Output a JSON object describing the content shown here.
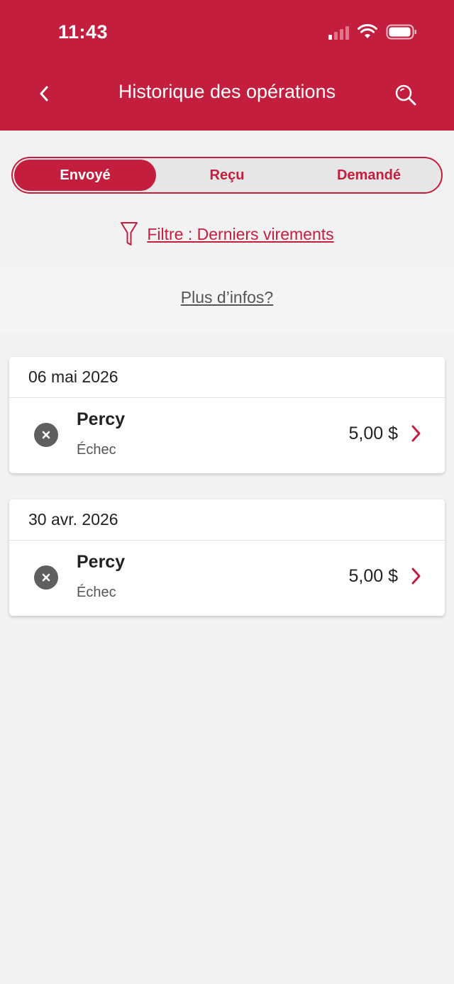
{
  "status_bar": {
    "time": "11:43"
  },
  "header": {
    "title": "Historique des opérations",
    "back_icon": "chevron-left-icon",
    "search_icon": "search-icon",
    "background_color": "#c41e3f"
  },
  "tabs": [
    {
      "label": "Envoyé",
      "active": true
    },
    {
      "label": "Reçu",
      "active": false
    },
    {
      "label": "Demandé",
      "active": false
    }
  ],
  "filter": {
    "icon": "filter-icon",
    "label": "Filtre :  Derniers virements"
  },
  "more_info": {
    "label": "Plus d’infos?"
  },
  "transactions": [
    {
      "date": "06 mai 2026",
      "name": "Percy",
      "status": "Échec",
      "amount": "5,00 $",
      "status_icon": "close-circle-icon"
    },
    {
      "date": "30 avr. 2026",
      "name": "Percy",
      "status": "Échec",
      "amount": "5,00 $",
      "status_icon": "close-circle-icon"
    }
  ],
  "colors": {
    "accent": "#c41e3f",
    "background": "#f2f2f2",
    "failed_icon": "#5f5f5f"
  }
}
